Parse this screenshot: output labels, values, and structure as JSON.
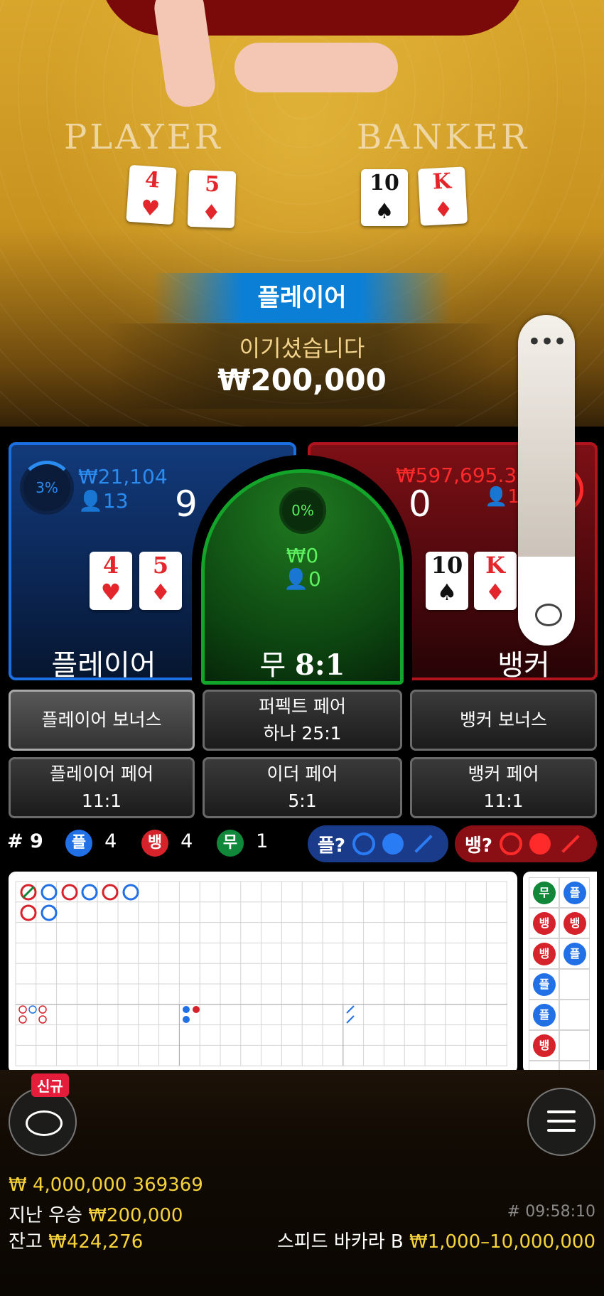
{
  "table": {
    "player_label": "PLAYER",
    "banker_label": "BANKER",
    "player_cards": [
      {
        "rank": "4",
        "suit": "♥",
        "color": "red"
      },
      {
        "rank": "5",
        "suit": "♦",
        "color": "red"
      }
    ],
    "banker_cards": [
      {
        "rank": "10",
        "suit": "♠",
        "color": "black"
      },
      {
        "rank": "K",
        "suit": "♦",
        "color": "red"
      }
    ]
  },
  "result": {
    "winner": "플레이어",
    "message": "이기셨습니다",
    "amount": "₩200,000"
  },
  "spots": {
    "player": {
      "percent": "3%",
      "amount": "₩21,104",
      "players": "13",
      "score": "9",
      "title": "플레이어",
      "cards": [
        {
          "rank": "4",
          "suit": "♥"
        },
        {
          "rank": "5",
          "suit": "♦"
        }
      ]
    },
    "tie": {
      "percent": "0%",
      "amount": "₩0",
      "players": "0",
      "title": "무",
      "payout": "8:1"
    },
    "banker": {
      "amount": "₩597,695.3",
      "players": "1",
      "score": "0",
      "title": "뱅커",
      "cards": [
        {
          "rank": "10",
          "suit": "♠"
        },
        {
          "rank": "K",
          "suit": "♦"
        }
      ]
    }
  },
  "side_bets": {
    "player_bonus": "플레이어 보너스",
    "perfect_pair_line1": "퍼펙트 페어",
    "perfect_pair_line2": "하나 25:1",
    "banker_bonus": "뱅커 보너스",
    "player_pair_line1": "플레이어 페어",
    "player_pair_line2": "11:1",
    "either_pair_line1": "이더 페어",
    "either_pair_line2": "5:1",
    "banker_pair_line1": "뱅커 페어",
    "banker_pair_line2": "11:1"
  },
  "stats": {
    "round": "# 9",
    "player_glyph": "플",
    "player_count": "4",
    "banker_glyph": "뱅",
    "banker_count": "4",
    "tie_glyph": "무",
    "tie_count": "1",
    "player_predict": "플?",
    "banker_predict": "뱅?"
  },
  "bead_road": [
    [
      "무",
      "플"
    ],
    [
      "뱅",
      "뱅"
    ],
    [
      "뱅",
      "플"
    ],
    [
      "플",
      ""
    ],
    [
      "플",
      ""
    ],
    [
      "뱅",
      ""
    ]
  ],
  "bottom": {
    "new_badge": "신규",
    "jackpot": "₩ 4,000,000 369369",
    "last_win_label": "지난 우승",
    "last_win_amount": "₩200,000",
    "balance_label": "잔고",
    "balance_amount": "₩424,276",
    "game_id": "# 09:58:10",
    "table_name": "스피드 바카라 B",
    "limits": "₩1,000–10,000,000"
  },
  "colors": {
    "player_blue": "#1b6fe0",
    "banker_red": "#d5222b",
    "tie_green": "#12a52a",
    "gold": "#f7d33b"
  }
}
